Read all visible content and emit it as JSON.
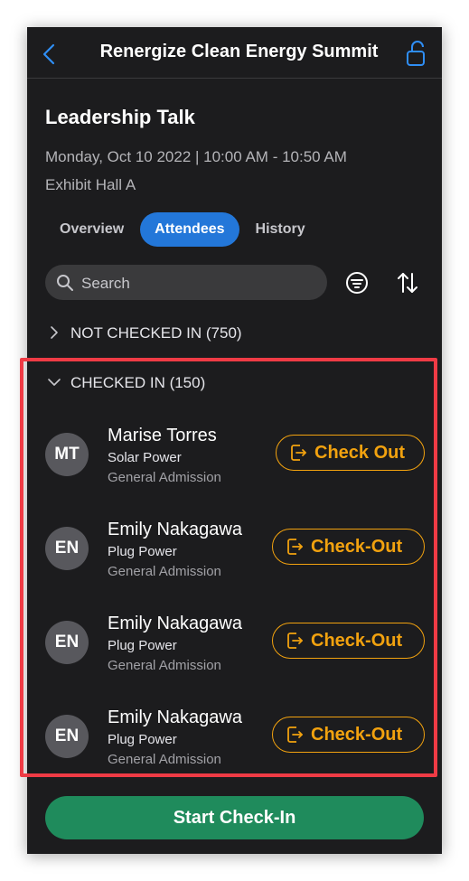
{
  "header": {
    "title": "Renergize Clean Energy Summit"
  },
  "session": {
    "title": "Leadership Talk",
    "datetime": "Monday, Oct 10 2022 | 10:00 AM - 10:50 AM",
    "location": "Exhibit Hall A"
  },
  "tabs": [
    {
      "label": "Overview",
      "active": false
    },
    {
      "label": "Attendees",
      "active": true
    },
    {
      "label": "History",
      "active": false
    }
  ],
  "search": {
    "placeholder": "Search"
  },
  "sections": {
    "not_checked_in": "NOT CHECKED IN (750)",
    "checked_in": "CHECKED IN (150)"
  },
  "attendees": [
    {
      "initials": "MT",
      "name": "Marise Torres",
      "company": "Solar Power",
      "ticket": "General Admission",
      "action": "Check Out"
    },
    {
      "initials": "EN",
      "name": "Emily Nakagawa",
      "company": "Plug Power",
      "ticket": "General Admission",
      "action": "Check-Out"
    },
    {
      "initials": "EN",
      "name": "Emily Nakagawa",
      "company": "Plug Power",
      "ticket": "General Admission",
      "action": "Check-Out"
    },
    {
      "initials": "EN",
      "name": "Emily Nakagawa",
      "company": "Plug Power",
      "ticket": "General Admission",
      "action": "Check-Out"
    }
  ],
  "footer": {
    "start_label": "Start Check-In"
  },
  "colors": {
    "background": "#1c1c1e",
    "accent_blue": "#2377d9",
    "checkout_orange": "#f2a20f",
    "start_green": "#1f8b5c",
    "highlight_red": "#ef3b45"
  },
  "icons": {
    "back": "chevron-left-icon",
    "lock": "unlock-icon",
    "search": "search-icon",
    "filter": "filter-icon",
    "sort": "sort-icon",
    "checkout": "sign-out-icon"
  }
}
